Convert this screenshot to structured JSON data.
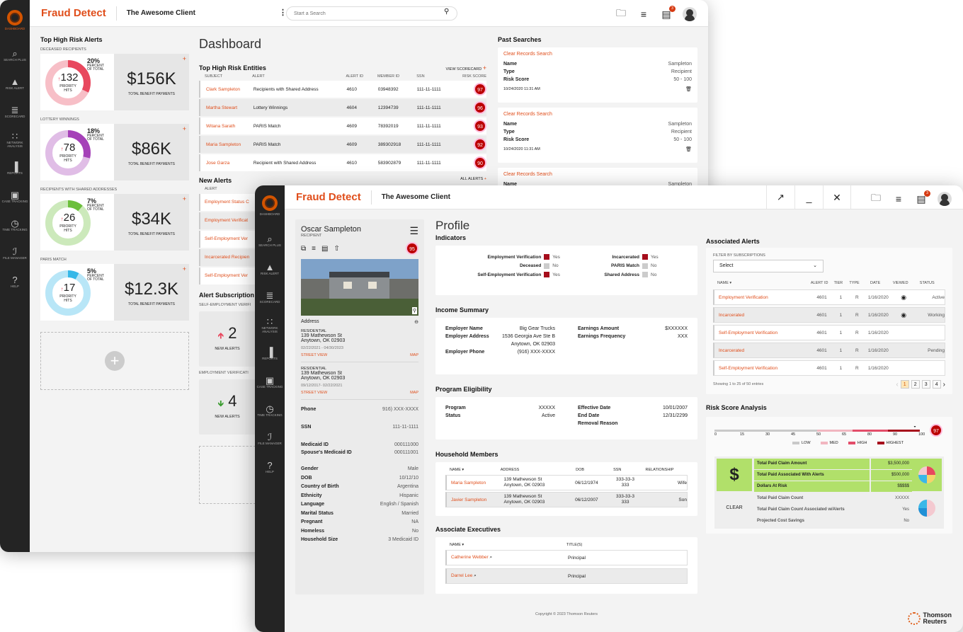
{
  "app": {
    "brand": "Fraud Detect",
    "client": "The Awesome Client",
    "search_placeholder": "Start a Search",
    "notif_count": "3"
  },
  "sidebar": {
    "items": [
      {
        "label": "Dashboard",
        "icon": "dashboard-logo"
      },
      {
        "label": "Search Plus",
        "icon": "search-icon"
      },
      {
        "label": "Risk Alert",
        "icon": "warning-icon"
      },
      {
        "label": "Scorecard",
        "icon": "scorecard-icon"
      },
      {
        "label": "Network Analysis",
        "icon": "network-icon"
      },
      {
        "label": "Reports",
        "icon": "bar-chart-icon"
      },
      {
        "label": "Case Tracking",
        "icon": "briefcase-icon"
      },
      {
        "label": "Time Tracking",
        "icon": "clock-icon"
      },
      {
        "label": "File Manager",
        "icon": "paperclip-icon"
      },
      {
        "label": "Help",
        "icon": "help-icon"
      }
    ]
  },
  "dashboard": {
    "title": "Dashboard",
    "alerts_title": "Top High Risk Alerts",
    "alerts": [
      {
        "category": "DECEASED RECIPIENTS",
        "percent": "20%",
        "percent_label": "PERCENT OF TOTAL",
        "hits": "132",
        "hits_label": "PRIORITY HITS",
        "amount": "$156K",
        "amount_label": "TOTAL BENEFIT PAYMENTS",
        "color": "#e8485e",
        "fraction": 0.2
      },
      {
        "category": "LOTTERY WINNINGS",
        "percent": "18%",
        "percent_label": "PERCENT OF TOTAL",
        "hits": "78",
        "hits_label": "PRIORITY HITS",
        "amount": "$86K",
        "amount_label": "TOTAL BENEFIT PAYMENTS",
        "color": "#a541b8",
        "fraction": 0.18
      },
      {
        "category": "RECIPIENTS WITH SHARED ADDRESSES",
        "percent": "7%",
        "percent_label": "PERCENT OF TOTAL",
        "hits": "26",
        "hits_label": "PRIORITY HITS",
        "amount": "$34K",
        "amount_label": "TOTAL BENEFIT PAYMENTS",
        "color": "#6cbf3c",
        "fraction": 0.07
      },
      {
        "category": "PARIS MATCH",
        "percent": "5%",
        "percent_label": "PERCENT OF TOTAL",
        "hits": "17",
        "hits_label": "PRIORITY HITS",
        "amount": "$12.3K",
        "amount_label": "TOTAL BENEFIT PAYMENTS",
        "color": "#35b8e8",
        "fraction": 0.05
      }
    ],
    "entities": {
      "title": "Top High Risk Entities",
      "view_label": "VIEW SCORECARD",
      "headers": [
        "SUBJECT",
        "ALERT",
        "ALERT ID",
        "MEMBER ID",
        "SSN",
        "RISK SCORE"
      ],
      "rows": [
        [
          "Clark Sampleton",
          "Recipients with Shared Address",
          "4610",
          "03948392",
          "111-11-1111",
          "97"
        ],
        [
          "Martha Stewart",
          "Lottery Winnings",
          "4604",
          "12394739",
          "111-11-1111",
          "96"
        ],
        [
          "Witana Sarath",
          "PARIS Match",
          "4609",
          "78392019",
          "111-11-1111",
          "93"
        ],
        [
          "Maria Sampleton",
          "PARIS Match",
          "4609",
          "389302918",
          "111-11-1111",
          "92"
        ],
        [
          "Jose Garza",
          "Recipient with Shared Address",
          "4610",
          "583902879",
          "111-11-1111",
          "90"
        ]
      ]
    },
    "new_alerts": {
      "title": "New Alerts",
      "header": "ALERT",
      "all_label": "ALL ALERTS",
      "items": [
        "Employment Status C",
        "Employment Verificat",
        "Self-Employment Ver",
        "Incarcerated Recipien",
        "Self-Employment Ver"
      ]
    },
    "subs": {
      "title": "Alert Subscription",
      "cat1": "SELF-EMPLOYMENT VERIFI",
      "val1": "2",
      "lab1": "NEW ALERTS",
      "cat2": "EMPLOYMENT VERIFICATI",
      "val2": "4",
      "lab2": "NEW ALERTS"
    },
    "past": {
      "title": "Past Searches",
      "items": [
        {
          "link": "Clear Records Search",
          "name": "Sampleton",
          "type": "Recipient",
          "score": "50 - 100",
          "date": "10/24/2020 11:31 AM"
        },
        {
          "link": "Clear Records Search",
          "name": "Sampleton",
          "type": "Recipient",
          "score": "50 - 100",
          "date": "10/24/2020 11:31 AM"
        },
        {
          "link": "Clear Records Search",
          "name": "Sampleton"
        }
      ],
      "name_label": "Name",
      "type_label": "Type",
      "score_label": "Risk Score"
    }
  },
  "profile": {
    "title": "Profile",
    "person": {
      "name": "Oscar Sampleton",
      "role": "RECIPIENT",
      "score": "95"
    },
    "address_label": "Address",
    "addresses": [
      {
        "kind": "RESIDENTIAL",
        "line1": "139 Mathewson St",
        "line2": "Anytown, OK 02903",
        "dates": "02/22/2021 - 04/30/2023",
        "street": "STREET VIEW",
        "map": "MAP"
      },
      {
        "kind": "RESIDENTIAL",
        "line1": "139 Mathewson St",
        "line2": "Anytown, OK 02903",
        "dates": "09/12/2017- 02/22/2021",
        "street": "STREET VIEW",
        "map": "MAP"
      }
    ],
    "phone": {
      "label": "Phone",
      "value": "916) XXX-XXXX"
    },
    "ssn": {
      "label": "SSN",
      "value": "111-11-1111"
    },
    "ids": [
      [
        "Medicaid ID",
        "000111000"
      ],
      [
        "Spouse's Medicaid ID",
        "000111001"
      ]
    ],
    "details": [
      [
        "Gender",
        "Male"
      ],
      [
        "DOB",
        "10/12/10"
      ],
      [
        "Country of Birth",
        "Argentina"
      ],
      [
        "Ethnicity",
        "Hispanic"
      ],
      [
        "Language",
        "English / Spanish"
      ],
      [
        "Marital Status",
        "Married"
      ],
      [
        "Pregnant",
        "NA"
      ],
      [
        "Homeless",
        "No"
      ],
      [
        "Household Size",
        "3 Medicaid ID"
      ]
    ],
    "indicators": {
      "title": "Indicators",
      "left": [
        [
          "Employment Verification",
          "Yes",
          true
        ],
        [
          "Deceased",
          "No",
          false
        ],
        [
          "Self-Employment Verification",
          "Yes",
          true
        ]
      ],
      "right": [
        [
          "Incarcerated",
          "Yes",
          true
        ],
        [
          "PARIS Match",
          "No",
          false
        ],
        [
          "Shared Address",
          "No",
          false
        ]
      ]
    },
    "income": {
      "title": "Income Summary",
      "employer_name": [
        "Employer Name",
        "Big Gear Trucks"
      ],
      "employer_address": [
        "Employer Address",
        "1536 Georgia Ave Ste B",
        "Anytown, OK 02903"
      ],
      "employer_phone": [
        "Employer Phone",
        "(916) XXX-XXXX"
      ],
      "earnings_amount": [
        "Earnings Amount",
        "$XXXXXX"
      ],
      "earnings_freq": [
        "Earnings Frequency",
        "XXX"
      ]
    },
    "eligibility": {
      "title": "Program Eligibility",
      "program": [
        "Program",
        "XXXXX"
      ],
      "status": [
        "Status",
        "Active"
      ],
      "effective": [
        "Effective Date",
        "10/01/2007"
      ],
      "end": [
        "End Date",
        "12/31/2299"
      ],
      "removal": "Removal Reason"
    },
    "household": {
      "title": "Household Members",
      "headers": [
        "NAME",
        "ADDRESS",
        "DOB",
        "SSN",
        "RELATIONSHIP"
      ],
      "rows": [
        [
          "Maria Sampleton",
          "139 Mathewson St",
          "Anytown, OK 02903",
          "06/12/1974",
          "333-33-3",
          "333",
          "Wife"
        ],
        [
          "Javier Sampleton",
          "139 Mathewson St",
          "Anytown, OK 02903",
          "06/12/2007",
          "333-33-3",
          "333",
          "Son"
        ]
      ]
    },
    "executives": {
      "title": "Associate Executives",
      "headers": [
        "NAME",
        "TITLE(S)"
      ],
      "rows": [
        [
          "Catherine Webber",
          "Principal"
        ],
        [
          "Darrel Lee",
          "Principal"
        ]
      ]
    },
    "copyright": "Copyright © 2023 Thomson Reuters",
    "assoc": {
      "title": "Associated Alerts",
      "filter_label": "FILTER BY SUBSCRIPTIONS",
      "select": "Select",
      "headers": [
        "NAME",
        "ALERT ID",
        "TIER",
        "TYPE",
        "DATE",
        "VIEWED",
        "STATUS"
      ],
      "rows": [
        [
          "Employment Verification",
          "4601",
          "1",
          "R",
          "1/16/2020",
          true,
          "Active"
        ],
        [
          "Incarcerated",
          "4601",
          "1",
          "R",
          "1/16/2020",
          true,
          "Working"
        ],
        [
          "Self-Employment Verification",
          "4601",
          "1",
          "R",
          "1/16/2020",
          false,
          ""
        ],
        [
          "Incarcerated",
          "4601",
          "1",
          "R",
          "1/16/2020",
          false,
          "Pending"
        ],
        [
          "Self-Employment Verification",
          "4601",
          "1",
          "R",
          "1/16/2020",
          false,
          ""
        ]
      ],
      "showing": "Showing 1 to 25 of 50 entries",
      "pages": [
        "1",
        "2",
        "3",
        "4"
      ]
    },
    "risk": {
      "title": "Risk Score Analysis",
      "ticks": [
        "0",
        "15",
        "30",
        "45",
        "50",
        "65",
        "80",
        "90",
        "100"
      ],
      "score": "97",
      "legend": [
        "LOW",
        "MED",
        "HIGH",
        "HIGHEST"
      ],
      "rows1": [
        [
          "Total Paid Claim Amount",
          "$3,500,000"
        ],
        [
          "Total Paid Associated With Alerts",
          "$500,000"
        ],
        [
          "Dollars At Risk",
          "$$$$$"
        ]
      ],
      "rows2": [
        [
          "Total Paid Claim Count",
          "XXXXX"
        ],
        [
          "Total Paid Claim Count Associated w/Alerts",
          "Yes"
        ],
        [
          "Projected Cost Savings",
          "No"
        ]
      ],
      "clear": "CLEAR"
    },
    "brand_footer": [
      "Thomson",
      "Reuters"
    ]
  }
}
